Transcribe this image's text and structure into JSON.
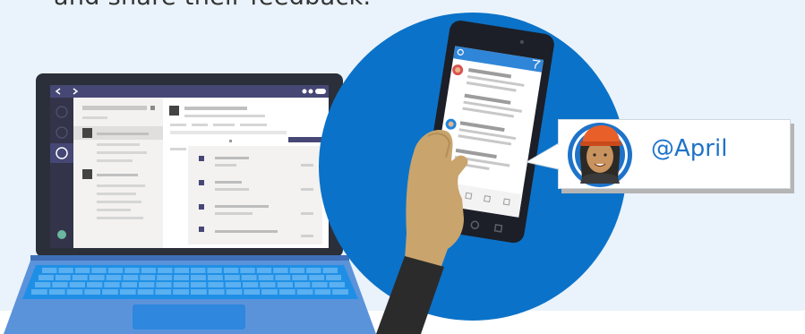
{
  "caption": {
    "text": "and share their feedback."
  },
  "mention": {
    "text": "@April"
  },
  "colors": {
    "background": "#eaf3fb",
    "circle": "#0b72c9",
    "laptop_shell": "#5b8fd6",
    "keyboard": "#1d86e0",
    "teams_sidebar": "#37385f",
    "accent_purple": "#464775",
    "mention_text": "#1e73c9",
    "phone_header": "#2f85d8",
    "hand": "#c9a46c",
    "sleeve": "#2b2b2b"
  },
  "icons": [
    "back-arrow-icon",
    "forward-arrow-icon",
    "search-icon",
    "filter-icon",
    "avatar-icon"
  ]
}
